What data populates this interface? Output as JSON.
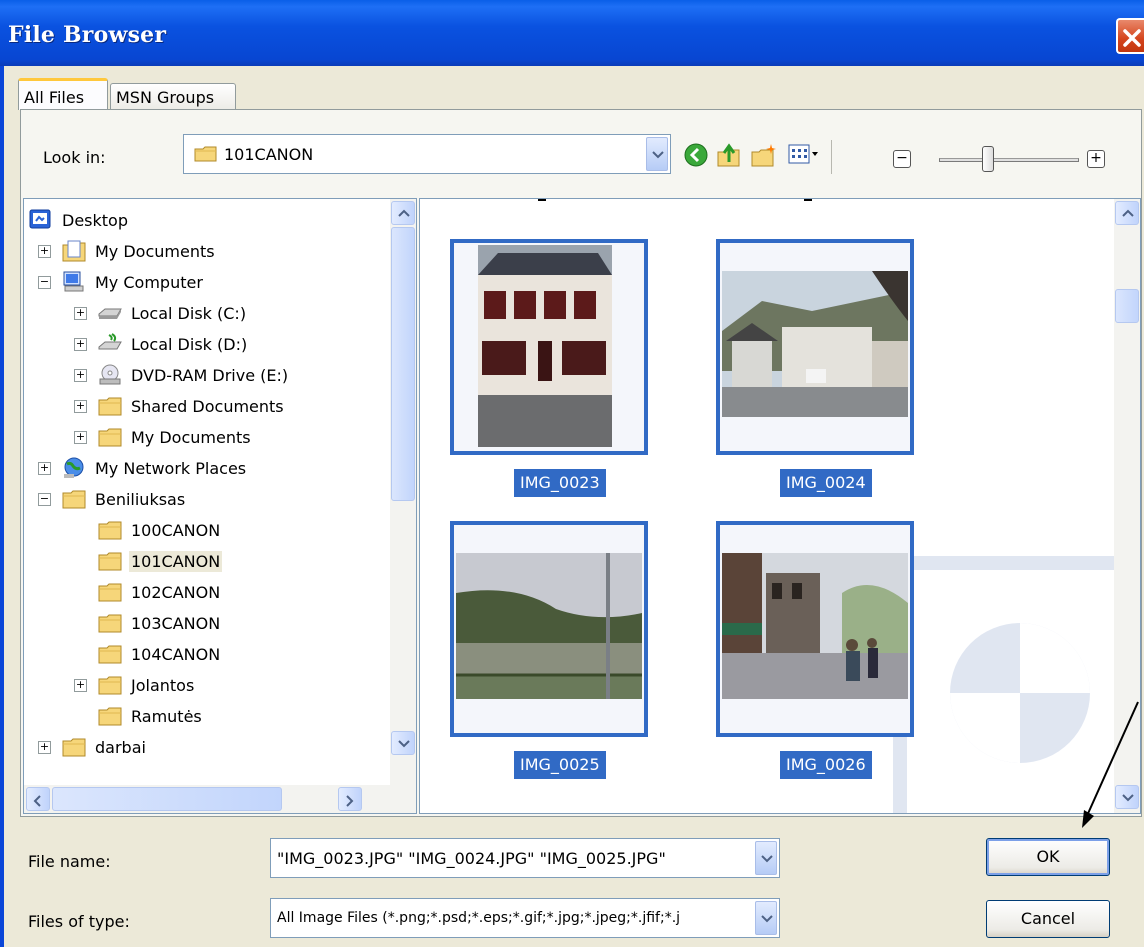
{
  "window": {
    "title": "File Browser"
  },
  "tabs": [
    {
      "label": "All Files"
    },
    {
      "label": "MSN Groups"
    }
  ],
  "lookin": {
    "label": "Look in:",
    "value": "101CANON"
  },
  "tree": {
    "items": [
      {
        "label": "Desktop"
      },
      {
        "label": "My Documents"
      },
      {
        "label": "My Computer"
      },
      {
        "label": "Local Disk (C:)"
      },
      {
        "label": "Local Disk (D:)"
      },
      {
        "label": "DVD-RAM Drive (E:)"
      },
      {
        "label": "Shared Documents"
      },
      {
        "label": "My Documents"
      },
      {
        "label": "My Network Places"
      },
      {
        "label": "Beniliuksas"
      },
      {
        "label": "100CANON"
      },
      {
        "label": "101CANON"
      },
      {
        "label": "102CANON"
      },
      {
        "label": "103CANON"
      },
      {
        "label": "104CANON"
      },
      {
        "label": "Jolantos"
      },
      {
        "label": "Ramutės"
      },
      {
        "label": "darbai"
      }
    ]
  },
  "thumbnails": [
    {
      "name": "IMG_0023"
    },
    {
      "name": "IMG_0024"
    },
    {
      "name": "IMG_0025"
    },
    {
      "name": "IMG_0026"
    }
  ],
  "filename": {
    "label": "File name:",
    "value": "\"IMG_0023.JPG\" \"IMG_0024.JPG\" \"IMG_0025.JPG\""
  },
  "filetype": {
    "label": "Files of type:",
    "value": "All Image Files (*.png;*.psd;*.eps;*.gif;*.jpg;*.jpeg;*.jfif;*.j"
  },
  "buttons": {
    "ok": "OK",
    "cancel": "Cancel"
  },
  "zoom": {
    "minus": "−",
    "plus": "+",
    "level": 0.35
  }
}
